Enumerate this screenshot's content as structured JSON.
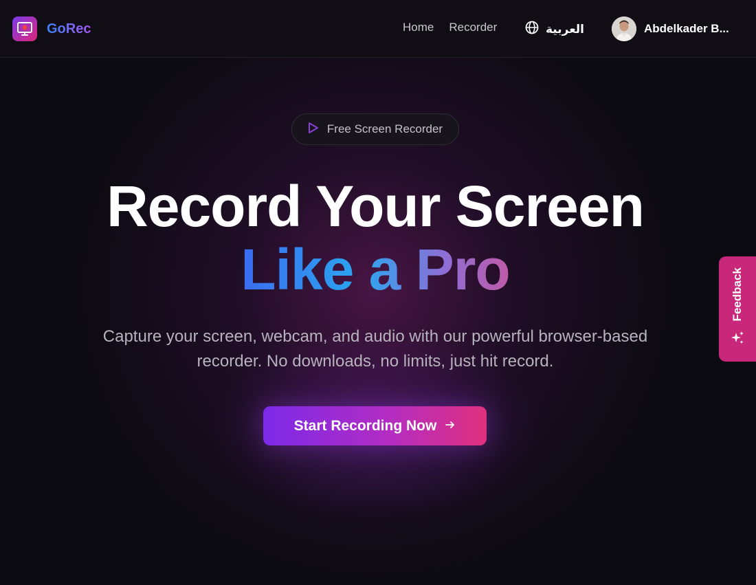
{
  "header": {
    "logo_text": "GoRec",
    "nav": [
      {
        "label": "Home"
      },
      {
        "label": "Recorder"
      }
    ],
    "language_label": "العربية",
    "user_name": "Abdelkader B..."
  },
  "hero": {
    "badge_label": "Free Screen Recorder",
    "headline_line1": "Record Your Screen",
    "headline_line2": "Like a Pro",
    "subtitle_line1": "Capture your screen, webcam, and audio with our powerful browser-based",
    "subtitle_line2": "recorder. No downloads, no limits, just hit record.",
    "cta_label": "Start Recording Now"
  },
  "feedback": {
    "label": "Feedback"
  },
  "icons": {
    "logo": "monitor-record-icon",
    "language": "globe-icon",
    "badge": "play-icon",
    "cta": "arrow-right-icon",
    "feedback": "sparkles-icon"
  },
  "colors": {
    "accent_purple": "#7c3aed",
    "accent_pink": "#db2777",
    "feedback_tab": "#c8277a",
    "background": "#0d0b12"
  }
}
